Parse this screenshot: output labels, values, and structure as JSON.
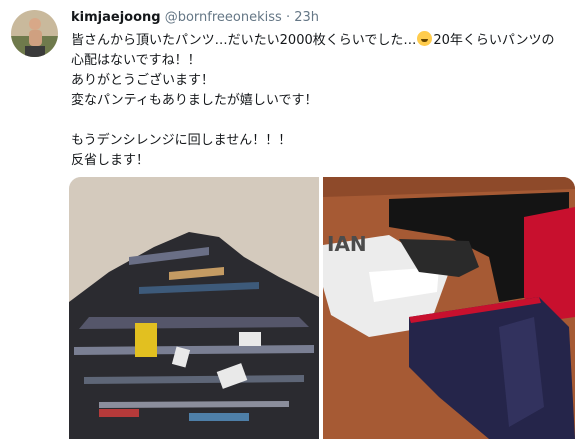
{
  "tweet": {
    "display_name": "kimjaejoong",
    "handle": "@bornfreeonekiss",
    "separator": "·",
    "time": "23h",
    "lines": [
      "皆さんから頂いたパンツ…だいたい2000枚くらいでした…",
      "20年くらいパンツの",
      "心配はないですね！！",
      "ありがとうございます！",
      "変なパンティもありましたが嬉しいです！",
      "もうデンシレンジに回しません！！！",
      "反省します！"
    ],
    "emoji_icon": "rolling-on-floor-laughing-emoji"
  },
  "media": {
    "left_photo_icon": "pile-of-underwear-photo",
    "right_photo_icon": "lace-underwear-photo",
    "right_photo_printed_text": "IAN"
  }
}
